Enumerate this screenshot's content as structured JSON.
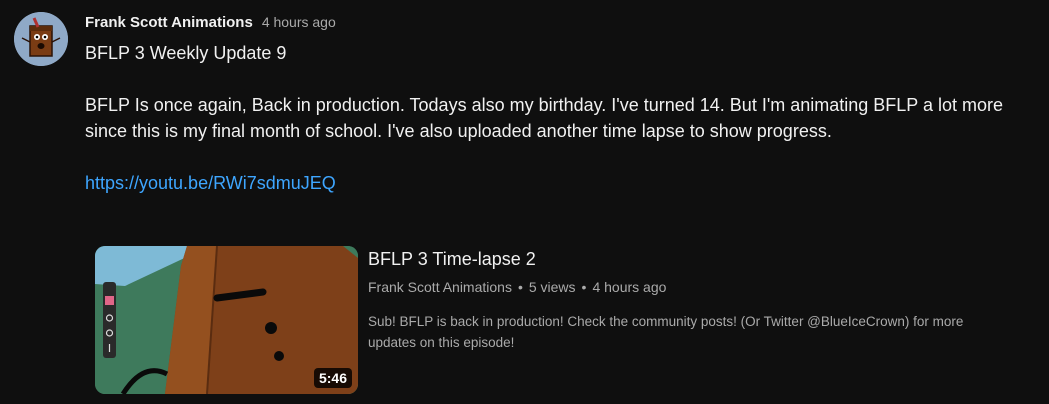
{
  "post": {
    "author": "Frank Scott Animations",
    "time": "4 hours ago",
    "title": "BFLP 3 Weekly Update 9",
    "body": "BFLP Is once again, Back in production. Todays also my birthday. I've turned 14. But I'm animating BFLP a lot more since this is my final month of school. I've also uploaded another time lapse to show progress.",
    "link": "https://youtu.be/RWi7sdmuJEQ"
  },
  "video": {
    "title": "BFLP 3 Time-lapse 2",
    "channel": "Frank Scott Animations",
    "separator": "•",
    "views": "5 views",
    "age": "4 hours ago",
    "description": "Sub! BFLP is back in production! Check the community posts! (Or Twitter @BlueIceCrown) for more updates on this episode!",
    "duration": "5:46"
  },
  "colors": {
    "background": "#0f0f0f",
    "text_primary": "#f1f1f1",
    "text_secondary": "#aaaaaa",
    "link": "#3ea6ff"
  }
}
